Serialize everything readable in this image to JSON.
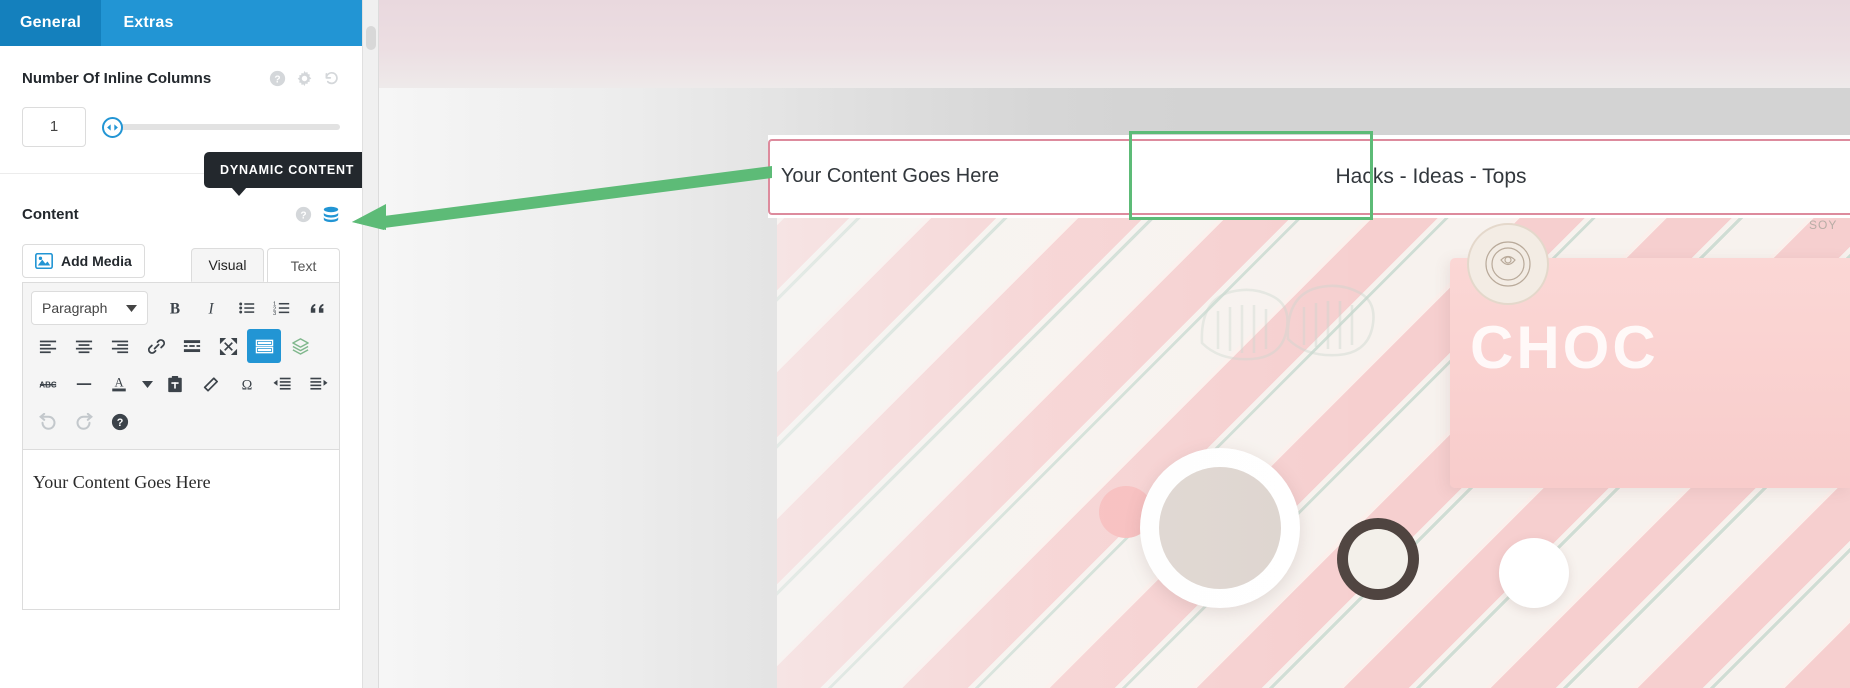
{
  "panel": {
    "tabs": [
      {
        "label": "General",
        "active": true
      },
      {
        "label": "Extras",
        "active": false
      }
    ],
    "inline_columns": {
      "label": "Number Of Inline Columns",
      "value": "1",
      "icons": [
        "help-icon",
        "gear-icon",
        "reset-icon"
      ]
    },
    "content_field": {
      "label": "Content",
      "icons": [
        "help-icon",
        "dynamic-content-icon"
      ]
    },
    "tooltip": {
      "text": "DYNAMIC CONTENT"
    },
    "editor": {
      "add_media_label": "Add Media",
      "mode_tabs": [
        {
          "label": "Visual",
          "active": true
        },
        {
          "label": "Text",
          "active": false
        }
      ],
      "format_select": "Paragraph",
      "toolbar_row1": [
        "bold-icon",
        "italic-icon",
        "bulleted-list-icon",
        "numbered-list-icon",
        "blockquote-icon"
      ],
      "toolbar_row2": [
        "align-left-icon",
        "align-center-icon",
        "align-right-icon",
        "link-icon",
        "read-more-icon",
        "fullscreen-icon",
        "toolbar-toggle-icon",
        "layers-icon"
      ],
      "toolbar_row3": [
        "strikethrough-icon",
        "horizontal-rule-icon",
        "text-color-icon",
        "color-dropdown-icon",
        "paste-as-text-icon",
        "clear-formatting-icon",
        "special-character-icon",
        "outdent-icon",
        "indent-icon"
      ],
      "toolbar_row4": [
        "undo-icon",
        "redo-icon",
        "keyboard-help-icon"
      ],
      "body_text": "Your Content Goes Here"
    }
  },
  "preview": {
    "content_bar": {
      "column_a_text": "Your Content Goes Here",
      "column_b_text": "Hacks - Ideas - Tops"
    },
    "photo": {
      "choc_text": "CHOC",
      "corner_text": "SOY"
    },
    "highlight": {
      "green_outline_color": "#5dbb77",
      "pink_outline_color": "#dd8b9d",
      "arrow_color": "#5dbb77"
    }
  }
}
